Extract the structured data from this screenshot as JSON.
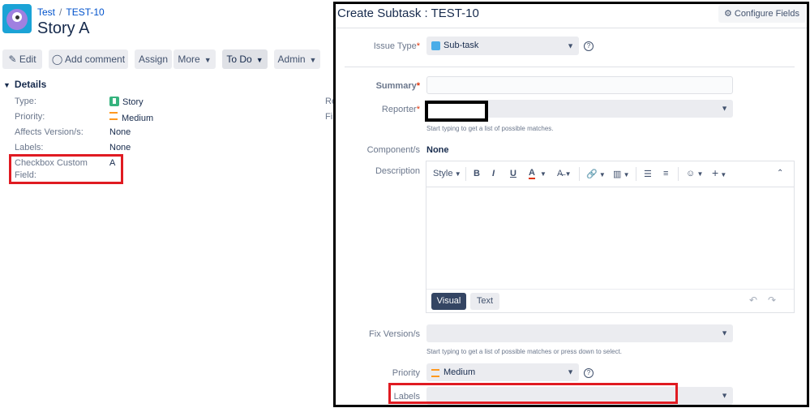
{
  "issue": {
    "breadcrumb_project": "Test",
    "breadcrumb_sep": "/",
    "breadcrumb_key": "TEST-10",
    "title": "Story A",
    "toolbar": {
      "edit": "Edit",
      "add_comment": "Add comment",
      "assign": "Assign",
      "more": "More",
      "status": "To Do",
      "admin": "Admin"
    },
    "details_heading": "Details",
    "fields": [
      {
        "label": "Type:",
        "value": "Story"
      },
      {
        "label": "Priority:",
        "value": "Medium"
      },
      {
        "label": "Affects Version/s:",
        "value": "None"
      },
      {
        "label": "Labels:",
        "value": "None"
      },
      {
        "label": "Checkbox Custom",
        "label2": "Field:",
        "value": "A"
      }
    ],
    "right_peek_1": "Re",
    "right_peek_2": "Fi"
  },
  "dialog": {
    "title": "Create Subtask : TEST-10",
    "configure_fields": "Configure Fields",
    "issue_type_label": "Issue Type",
    "issue_type_value": "Sub-task",
    "summary_label": "Summary",
    "reporter_label": "Reporter",
    "reporter_hint": "Start typing to get a list of possible matches.",
    "component_label": "Component/s",
    "component_value": "None",
    "description_label": "Description",
    "editor_style": "Style",
    "editor_visual": "Visual",
    "editor_text": "Text",
    "fix_version_label": "Fix Version/s",
    "fix_version_hint": "Start typing to get a list of possible matches or press down to select.",
    "priority_label": "Priority",
    "priority_value": "Medium",
    "labels_label": "Labels",
    "required_mark": "*",
    "help_mark": "?"
  },
  "colors": {
    "highlight_red": "#e01b22",
    "link_blue": "#0052cc",
    "visual_tab": "#344563"
  }
}
